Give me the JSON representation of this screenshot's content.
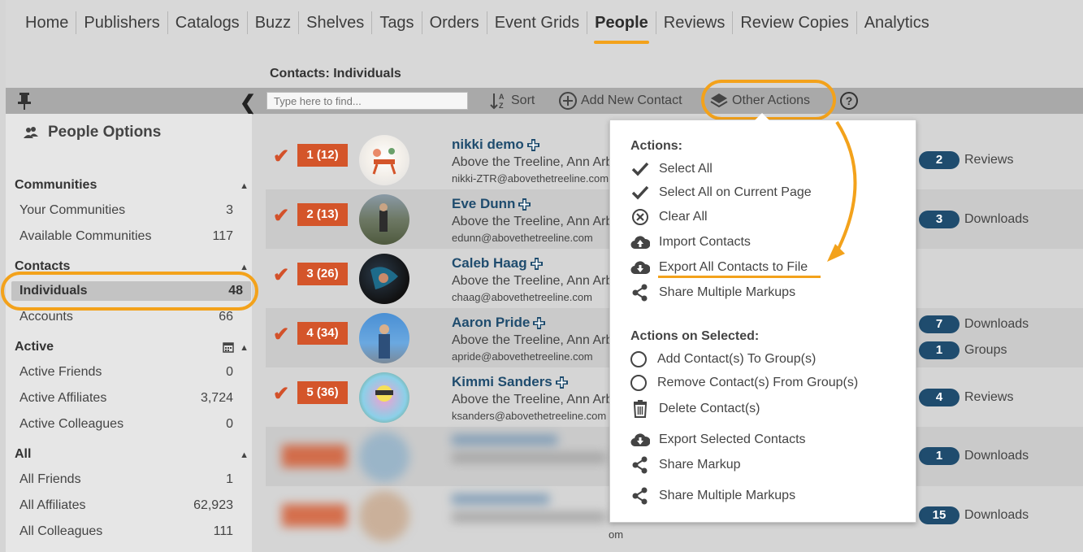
{
  "nav": {
    "items": [
      "Home",
      "Publishers",
      "Catalogs",
      "Buzz",
      "Shelves",
      "Tags",
      "Orders",
      "Event Grids",
      "People",
      "Reviews",
      "Review Copies",
      "Analytics"
    ],
    "active": "People"
  },
  "breadcrumb": "Contacts: Individuals",
  "toolbar": {
    "search_placeholder": "Type here to find...",
    "sort_label": "Sort",
    "add_label": "Add New Contact",
    "other_label": "Other Actions"
  },
  "sidebar": {
    "title": "People Options",
    "sections": [
      {
        "title": "Communities",
        "rows": [
          {
            "label": "Your Communities",
            "count": "3"
          },
          {
            "label": "Available Communities",
            "count": "117"
          }
        ]
      },
      {
        "title": "Contacts",
        "rows": [
          {
            "label": "Individuals",
            "count": "48"
          },
          {
            "label": "Accounts",
            "count": "66"
          }
        ]
      },
      {
        "title": "Active",
        "rows": [
          {
            "label": "Active Friends",
            "count": "0"
          },
          {
            "label": "Active Affiliates",
            "count": "3,724"
          },
          {
            "label": "Active Colleagues",
            "count": "0"
          }
        ]
      },
      {
        "title": "All",
        "rows": [
          {
            "label": "All Friends",
            "count": "1"
          },
          {
            "label": "All Affiliates",
            "count": "62,923"
          },
          {
            "label": "All Colleagues",
            "count": "111"
          }
        ]
      }
    ]
  },
  "contacts": [
    {
      "badge": "1 (12)",
      "name": "nikki demo",
      "org": "Above the Treeline, Ann Arbor",
      "email": "nikki-ZTR@abovethetreeline.com",
      "stats": [
        {
          "n": "2",
          "label": "Reviews"
        }
      ]
    },
    {
      "badge": "2 (13)",
      "name": "Eve Dunn",
      "org": "Above the Treeline, Ann Arbor",
      "email": "edunn@abovethetreeline.com",
      "stats": [
        {
          "n": "3",
          "label": "Downloads"
        }
      ]
    },
    {
      "badge": "3 (26)",
      "name": "Caleb Haag",
      "org": "Above the Treeline, Ann Arbor",
      "email": "chaag@abovethetreeline.com",
      "stats": []
    },
    {
      "badge": "4 (34)",
      "name": "Aaron Pride",
      "org": "Above the Treeline, Ann Arbor",
      "email": "apride@abovethetreeline.com",
      "stats": [
        {
          "n": "7",
          "label": "Downloads"
        },
        {
          "n": "1",
          "label": "Groups"
        }
      ]
    },
    {
      "badge": "5 (36)",
      "name": "Kimmi Sanders",
      "org": "Above the Treeline, Ann Arbor",
      "email": "ksanders@abovethetreeline.com",
      "stats": [
        {
          "n": "4",
          "label": "Reviews"
        }
      ]
    },
    {
      "badge": "",
      "name": "",
      "org": "",
      "email": "",
      "stats": [
        {
          "n": "1",
          "label": "Downloads"
        }
      ]
    },
    {
      "badge": "",
      "name": "",
      "org": "",
      "email": "om",
      "stats": [
        {
          "n": "15",
          "label": "Downloads"
        }
      ]
    }
  ],
  "dropdown": {
    "actions_title": "Actions:",
    "actions": [
      {
        "icon": "check-icon",
        "label": "Select All"
      },
      {
        "icon": "check-icon",
        "label": "Select All on Current Page"
      },
      {
        "icon": "x-circle-icon",
        "label": "Clear All"
      },
      {
        "icon": "cloud-upload-icon",
        "label": "Import Contacts"
      },
      {
        "icon": "cloud-download-icon",
        "label": "Export All Contacts to File"
      },
      {
        "icon": "share-icon",
        "label": "Share Multiple Markups"
      }
    ],
    "selected_title": "Actions on Selected:",
    "selected_actions": [
      {
        "icon": "radio-icon",
        "label": "Add Contact(s) To Group(s)"
      },
      {
        "icon": "radio-icon",
        "label": "Remove Contact(s) From Group(s)"
      },
      {
        "icon": "trash-icon",
        "label": "Delete Contact(s)"
      },
      {
        "icon": "cloud-download-icon",
        "label": "Export Selected Contacts"
      },
      {
        "icon": "share-icon",
        "label": "Share Markup"
      },
      {
        "icon": "share-icon",
        "label": "Share Multiple Markups"
      }
    ]
  },
  "colors": {
    "accent_orange": "#f3a21b",
    "badge_red": "#d4552a",
    "pill_navy": "#1f4c6e"
  }
}
